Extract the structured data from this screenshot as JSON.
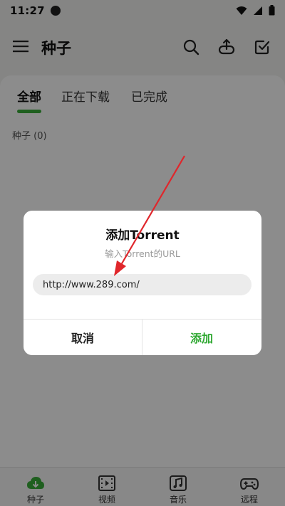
{
  "status_bar": {
    "time": "11:27"
  },
  "app_bar": {
    "title": "种子"
  },
  "tabs": [
    {
      "label": "全部"
    },
    {
      "label": "正在下载"
    },
    {
      "label": "已完成"
    }
  ],
  "section": {
    "label": "种子 (0)"
  },
  "dialog": {
    "title": "添加Torrent",
    "subtitle": "输入Torrent的URL",
    "url_value": "http://www.289.com/",
    "cancel_label": "取消",
    "add_label": "添加"
  },
  "bottom_nav": [
    {
      "label": "种子"
    },
    {
      "label": "视频"
    },
    {
      "label": "音乐"
    },
    {
      "label": "远程"
    }
  ],
  "colors": {
    "accent_green": "#2fa832",
    "annotation_red": "#e0262b"
  }
}
